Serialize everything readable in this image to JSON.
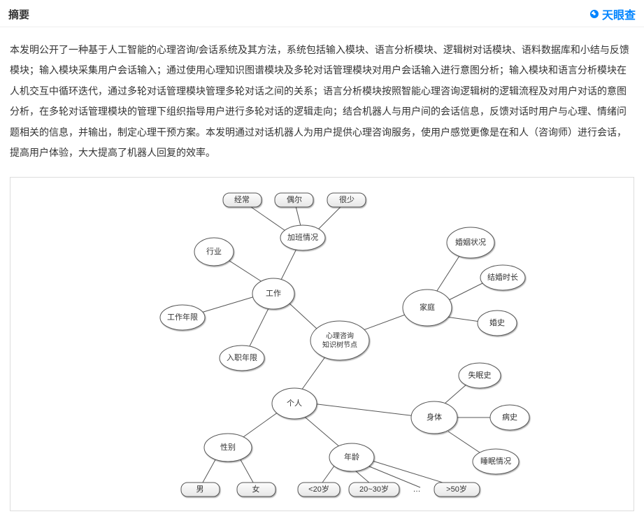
{
  "header": {
    "title": "摘要",
    "brand": "天眼查"
  },
  "abstract": "本发明公开了一种基于人工智能的心理咨询/会话系统及其方法，系统包括输入模块、语言分析模块、逻辑树对话模块、语料数据库和小结与反馈模块；输入模块采集用户会话输入；通过使用心理知识图谱模块及多轮对话管理模块对用户会话输入进行意图分析；输入模块和语言分析模块在人机交互中循环迭代，通过多轮对话管理模块管理多轮对话之间的关系；语言分析模块按照智能心理咨询逻辑树的逻辑流程及对用户对话的意图分析，在多轮对话管理模块的管理下组织指导用户进行多轮对话的逻辑走向；结合机器人与用户间的会话信息，反馈对话时用户与心理、情绪问题相关的信息，并输出，制定心理干预方案。本发明通过对话机器人为用户提供心理咨询服务，使用户感觉更像是在和人（咨询师）进行会话，提高用户体验，大大提高了机器人回复的效率。",
  "diagram": {
    "center": "心理咨询\n知识树节点",
    "nodes": {
      "work": "工作",
      "industry": "行业",
      "work_years": "工作年限",
      "entry_years": "入职年限",
      "overtime": "加班情况",
      "ot_often": "经常",
      "ot_sometimes": "偶尔",
      "ot_rare": "很少",
      "family": "家庭",
      "marital": "婚姻状况",
      "marriage_len": "结婚时长",
      "marriage_hist": "婚史",
      "personal": "个人",
      "gender": "性别",
      "male": "男",
      "female": "女",
      "age": "年龄",
      "age_lt20": "<20岁",
      "age_20_30": "20~30岁",
      "age_dots": "…",
      "age_gt50": ">50岁",
      "body": "身体",
      "insomnia": "失眠史",
      "illness": "病史",
      "sleep": "睡眠情况"
    }
  },
  "chart_data": {
    "type": "table",
    "description": "Knowledge-tree mind map for psychological counseling system",
    "root": "心理咨询知识树节点",
    "branches": [
      {
        "name": "工作",
        "children": [
          {
            "name": "行业"
          },
          {
            "name": "工作年限"
          },
          {
            "name": "入职年限"
          },
          {
            "name": "加班情况",
            "children": [
              {
                "name": "经常"
              },
              {
                "name": "偶尔"
              },
              {
                "name": "很少"
              }
            ]
          }
        ]
      },
      {
        "name": "家庭",
        "children": [
          {
            "name": "婚姻状况"
          },
          {
            "name": "结婚时长"
          },
          {
            "name": "婚史"
          }
        ]
      },
      {
        "name": "个人",
        "children": [
          {
            "name": "性别",
            "children": [
              {
                "name": "男"
              },
              {
                "name": "女"
              }
            ]
          },
          {
            "name": "年龄",
            "children": [
              {
                "name": "<20岁"
              },
              {
                "name": "20~30岁"
              },
              {
                "name": "…"
              },
              {
                "name": ">50岁"
              }
            ]
          },
          {
            "name": "身体",
            "children": [
              {
                "name": "失眠史"
              },
              {
                "name": "病史"
              },
              {
                "name": "睡眠情况"
              }
            ]
          }
        ]
      }
    ]
  }
}
